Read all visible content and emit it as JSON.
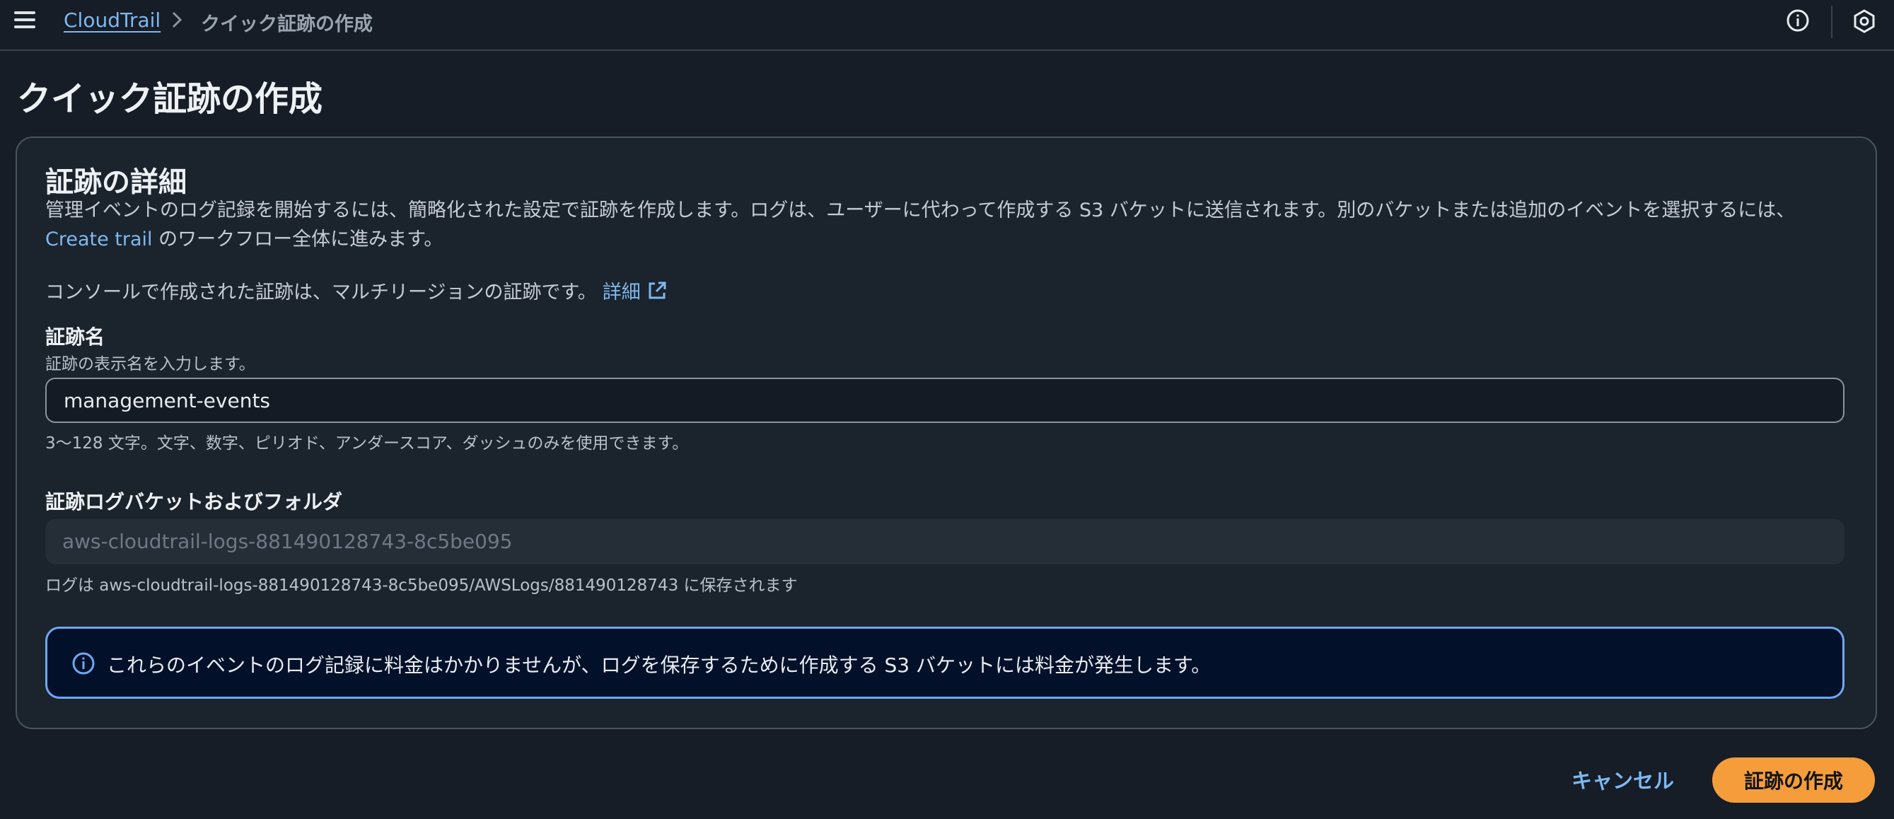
{
  "header": {
    "breadcrumb_root": "CloudTrail",
    "breadcrumb_current": "クイック証跡の作成"
  },
  "page": {
    "title": "クイック証跡の作成"
  },
  "details": {
    "title": "証跡の詳細",
    "description_part1": "管理イベントのログ記録を開始するには、簡略化された設定で証跡を作成します。ログは、ユーザーに代わって作成する S3 バケットに送信されます。別のバケットまたは追加のイベントを選択するには、",
    "description_link": "Create trail",
    "description_part2": " のワークフロー全体に進みます。",
    "multiregion_text": "コンソールで作成された証跡は、マルチリージョンの証跡です。",
    "multiregion_link": "詳細"
  },
  "trail_name": {
    "label": "証跡名",
    "sublabel": "証跡の表示名を入力します。",
    "value": "management-events",
    "constraint": "3〜128 文字。文字、数字、ピリオド、アンダースコア、ダッシュのみを使用できます。"
  },
  "bucket": {
    "label": "証跡ログバケットおよびフォルダ",
    "value": "aws-cloudtrail-logs-881490128743-8c5be095",
    "note": "ログは aws-cloudtrail-logs-881490128743-8c5be095/AWSLogs/881490128743 に保存されます"
  },
  "alert": {
    "text": "これらのイベントのログ記録に料金はかかりませんが、ログを保存するために作成する S3 バケットには料金が発生します。"
  },
  "actions": {
    "cancel": "キャンセル",
    "create": "証跡の作成"
  },
  "colors": {
    "background": "#161d26",
    "link": "#7eb8f0",
    "primary": "#f59d3b",
    "alert_border": "#6fa8f0"
  }
}
